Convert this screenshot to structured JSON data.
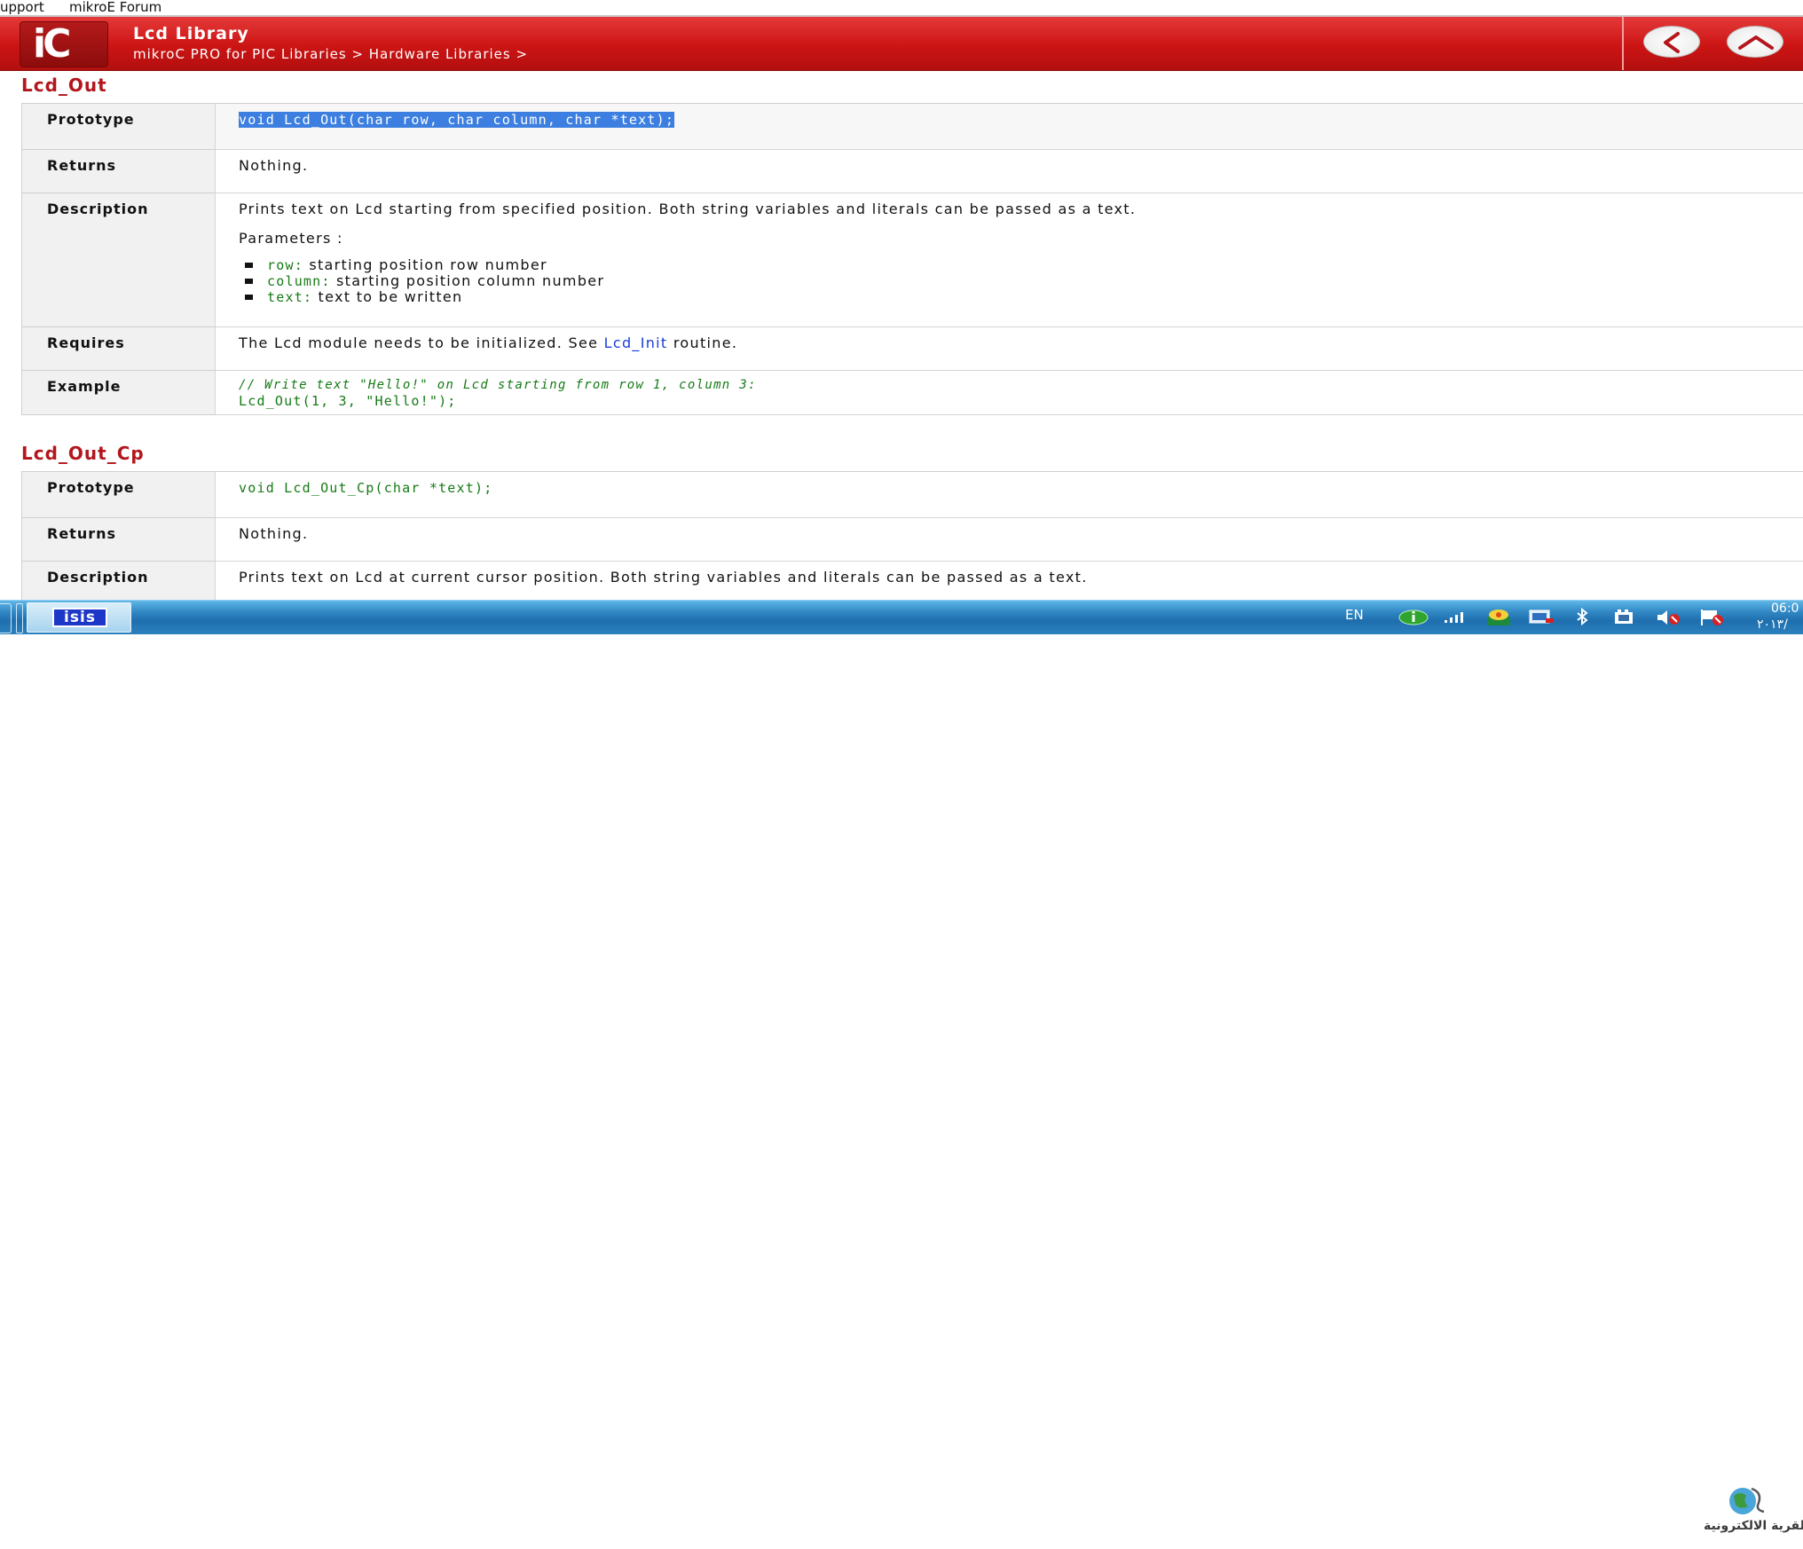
{
  "top_links": {
    "support": "upport",
    "forum": "mikroE Forum"
  },
  "header": {
    "logo_text": "iC",
    "title": "Lcd Library",
    "breadcrumb": "mikroC PRO for PIC Libraries > Hardware Libraries >",
    "colors": {
      "bar": "#cc1414",
      "title_text": "#ffffff"
    }
  },
  "sections": [
    {
      "title": "Lcd_Out",
      "rows": {
        "prototype_label": "Prototype",
        "prototype_code": "void Lcd_Out(char row, char column, char *text);",
        "returns_label": "Returns",
        "returns_text": "Nothing.",
        "description_label": "Description",
        "description_text": "Prints text on Lcd starting from specified position. Both string variables and literals can be passed as a text.",
        "parameters_label": "Parameters :",
        "params": [
          {
            "name": "row:",
            "desc": "starting position row number"
          },
          {
            "name": "column:",
            "desc": "starting position column number"
          },
          {
            "name": "text:",
            "desc": "text to be written"
          }
        ],
        "requires_label": "Requires",
        "requires_before": "The Lcd module needs to be initialized. See",
        "requires_link": "Lcd_Init",
        "requires_after": "routine.",
        "example_label": "Example",
        "example_comment": "// Write text \"Hello!\" on Lcd starting from row 1, column 3:",
        "example_code": "Lcd_Out(1, 3, \"Hello!\");"
      }
    },
    {
      "title": "Lcd_Out_Cp",
      "rows": {
        "prototype_label": "Prototype",
        "prototype_code": "void Lcd_Out_Cp(char *text);",
        "returns_label": "Returns",
        "returns_text": "Nothing.",
        "description_label": "Description",
        "description_text": "Prints text on Lcd at current cursor position. Both string variables and literals can be passed as a text."
      }
    }
  ],
  "taskbar": {
    "app_label": "isis",
    "language": "EN",
    "clock_time": "06:0",
    "clock_date": "٢٠١٣/",
    "tray_icons": [
      "info-icon",
      "signal-icon",
      "network-icon",
      "display-icon",
      "bluetooth-icon",
      "battery-icon",
      "volume-muted-icon",
      "flag-icon"
    ]
  },
  "watermark": {
    "text": "القرية الالكترونية"
  },
  "colors": {
    "section_title": "#b3161c",
    "code_green": "#157a15",
    "selection": "#3d7fe0",
    "link": "#1a3dd8",
    "taskbar": "#2f86c3"
  }
}
